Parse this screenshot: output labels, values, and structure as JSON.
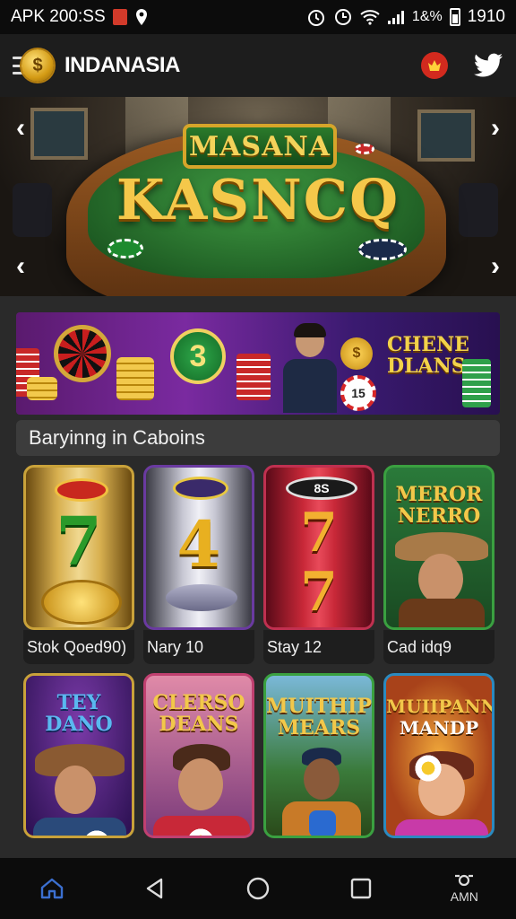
{
  "status_bar": {
    "left_text": "APK 200:SS",
    "right_text_signal": "1&%",
    "time": "1910"
  },
  "app": {
    "title": "INDANASIA",
    "logo_glyph": "$"
  },
  "hero": {
    "sign_top": "MASANA",
    "sign_main": "KASNCQ"
  },
  "promo": {
    "coin_number": "3",
    "chip_number": "15",
    "dollar_glyph": "$",
    "text_line1": "CHENE",
    "text_line2": "DLANS"
  },
  "section": {
    "title": "Baryinng in Caboins"
  },
  "games": [
    {
      "label": "Stok Qoed90)",
      "art_text": "7",
      "border": "#c9a23a"
    },
    {
      "label": "Nary 10",
      "art_text": "4",
      "border": "#6a3aa0"
    },
    {
      "label": "Stay 12",
      "art_text": "7",
      "art_text_top": "8S",
      "border": "#c03050"
    },
    {
      "label": "Cad idq9",
      "art_title_1": "MEROR",
      "art_title_2": "NERRO",
      "border": "#3aa040"
    },
    {
      "label": "",
      "art_title_1": "TEY",
      "art_title_2": "DANO",
      "border": "#c9a23a"
    },
    {
      "label": "",
      "art_title_1": "CLERSO",
      "art_title_2": "DEANS",
      "border": "#c04070"
    },
    {
      "label": "",
      "art_title_1": "MUITHIP",
      "art_title_2": "MEARS",
      "border": "#3aa040"
    },
    {
      "label": "",
      "art_title_1": "MUIIPANN",
      "art_title_2": "MANDP",
      "border": "#2a8ac0"
    }
  ],
  "nav": {
    "extra_label": "AMN"
  },
  "colors": {
    "accent_gold": "#f2c84a",
    "home_active": "#3b6fd0"
  }
}
